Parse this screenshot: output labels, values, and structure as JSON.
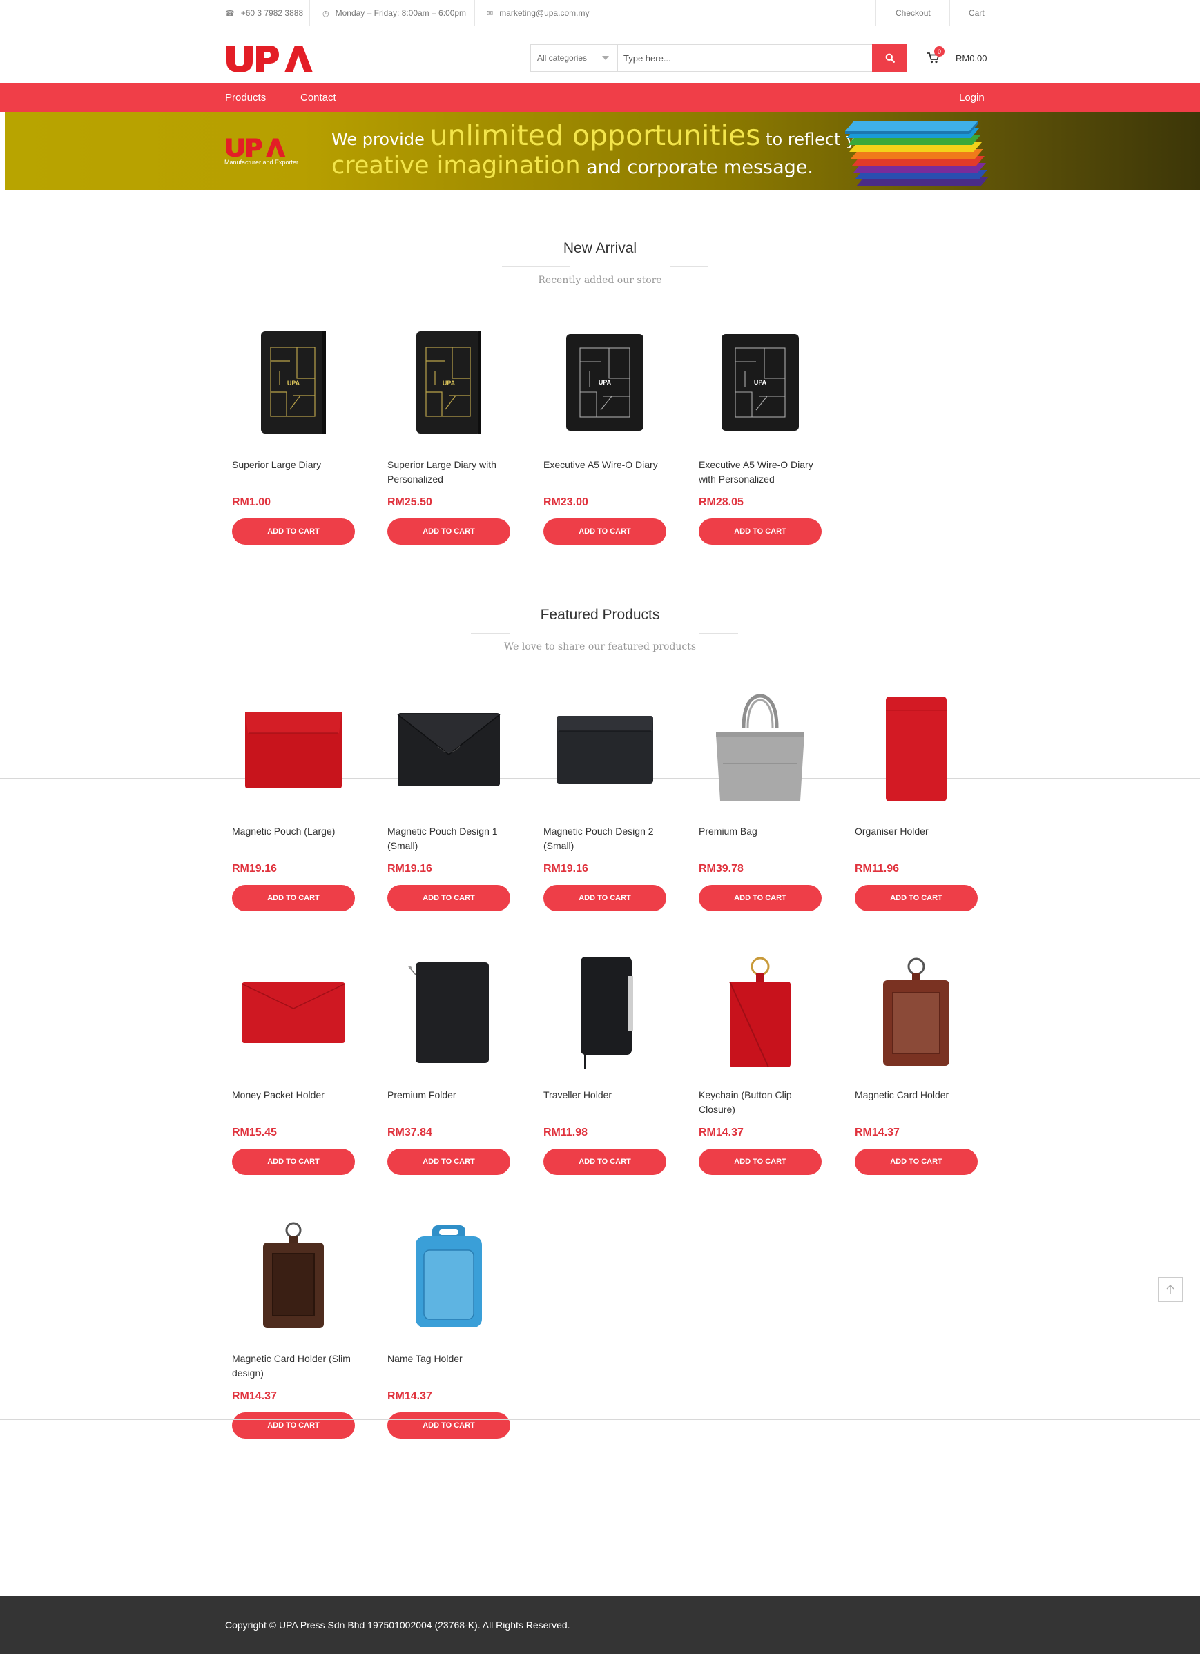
{
  "topbar": {
    "phone": "+60 3 7982 3888",
    "hours": "Monday – Friday: 8:00am – 6:00pm",
    "email": "marketing@upa.com.my",
    "checkout": "Checkout",
    "cart": "Cart"
  },
  "header": {
    "logo_text": "UPA",
    "category_select": "All categories",
    "search_placeholder": "Type here...",
    "cart_count": "0",
    "cart_total": "RM0.00"
  },
  "nav": {
    "products": "Products",
    "contact": "Contact",
    "login": "Login"
  },
  "banner": {
    "logo_text": "UPA",
    "tagline": "Manufacturer and Exporter",
    "line1_a": "We provide ",
    "line1_b": "unlimited opportunities",
    "line1_c": " to reflect your",
    "line2_a": "creative imagination",
    "line2_b": " and corporate message."
  },
  "new_arrival": {
    "title": "New Arrival",
    "subtitle": "Recently added our store",
    "products": [
      {
        "name": "Superior Large Diary",
        "price": "RM1.00",
        "button": "ADD TO CART"
      },
      {
        "name": "Superior Large Diary with Personalized",
        "price": "RM25.50",
        "button": "ADD TO CART"
      },
      {
        "name": "Executive A5 Wire-O Diary",
        "price": "RM23.00",
        "button": "ADD TO CART"
      },
      {
        "name": "Executive A5 Wire-O Diary with Personalized",
        "price": "RM28.05",
        "button": "ADD TO CART"
      }
    ]
  },
  "featured": {
    "title": "Featured Products",
    "subtitle": "We love to share our featured products",
    "products": [
      {
        "name": "Magnetic Pouch (Large)",
        "price": "RM19.16",
        "button": "ADD TO CART"
      },
      {
        "name": "Magnetic Pouch Design 1 (Small)",
        "price": "RM19.16",
        "button": "ADD TO CART"
      },
      {
        "name": "Magnetic Pouch Design 2 (Small)",
        "price": "RM19.16",
        "button": "ADD TO CART"
      },
      {
        "name": "Premium Bag",
        "price": "RM39.78",
        "button": "ADD TO CART"
      },
      {
        "name": "Organiser Holder",
        "price": "RM11.96",
        "button": "ADD TO CART"
      },
      {
        "name": "Money Packet Holder",
        "price": "RM15.45",
        "button": "ADD TO CART"
      },
      {
        "name": "Premium Folder",
        "price": "RM37.84",
        "button": "ADD TO CART"
      },
      {
        "name": "Traveller Holder",
        "price": "RM11.98",
        "button": "ADD TO CART"
      },
      {
        "name": "Keychain (Button Clip Closure)",
        "price": "RM14.37",
        "button": "ADD TO CART"
      },
      {
        "name": "Magnetic Card Holder",
        "price": "RM14.37",
        "button": "ADD TO CART"
      },
      {
        "name": "Magnetic Card Holder (Slim design)",
        "price": "RM14.37",
        "button": "ADD TO CART"
      },
      {
        "name": "Name Tag Holder",
        "price": "RM14.37",
        "button": "ADD TO CART"
      }
    ]
  },
  "footer": {
    "copyright": "Copyright © UPA Press Sdn Bhd 197501002004 (23768-K). All Rights Reserved."
  },
  "colors": {
    "brand_red": "#ee3e48",
    "price_red": "#e0323d",
    "footer_bg": "#343434",
    "banner_gold": "#b8a400"
  }
}
